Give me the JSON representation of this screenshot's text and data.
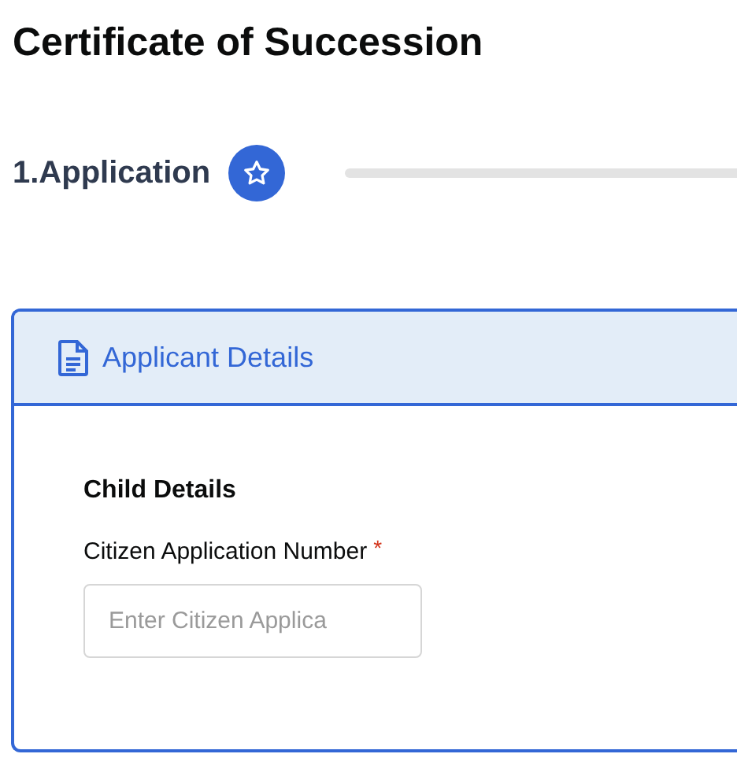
{
  "page": {
    "title": "Certificate of Succession"
  },
  "stepper": {
    "steps": [
      {
        "label": "1.Application",
        "selected": true
      }
    ]
  },
  "card": {
    "title": "Applicant Details",
    "section": "Child Details",
    "fields": [
      {
        "label": "Citizen Application Number",
        "required_mark": "*",
        "placeholder": "Enter Citizen Applica"
      }
    ]
  }
}
